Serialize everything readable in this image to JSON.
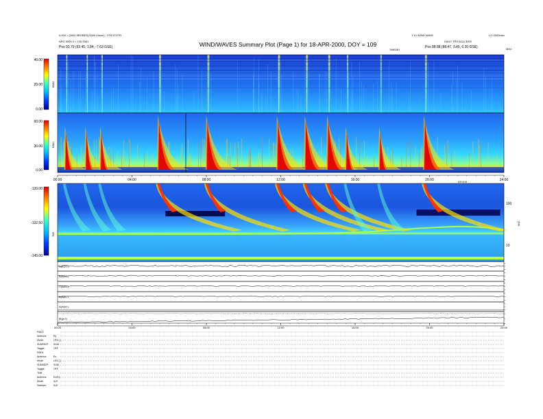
{
  "header": {
    "title": "WIND/WAVES Summary Plot (Page 1) for 18-APR-2000, DOY = 109",
    "tl_line1": "0.000 = [2000 0ROBES] 0000 (Vevlo) - 0T8 0TOTR",
    "tl_line2": "ARG 0000 2 = 130.0061",
    "tl_pos": "Pos    93.79 (93.45, 1.84, -7.63 GSE)",
    "tr_line1": "1.10 WIND WAVE",
    "tr_line2": "DAILY   TR0 0(11) 3002",
    "tr_pos": "Pos    88.88 (88.47, 3.45, 6.30 GSE)",
    "tr_corner": "LO 0000mhz",
    "mhz_label": "MHz",
    "khz_label": "KHZ",
    "time_corner_upper": "TIME/MH",
    "time_corner_lower": "DRY/DS"
  },
  "panels": {
    "rad2": {
      "name": "RAD2",
      "ticks": [
        "40.00",
        "20.00",
        "0.00"
      ]
    },
    "rad1": {
      "name": "RAD1",
      "ticks": [
        "60.00",
        "30.00",
        "0.00"
      ]
    },
    "tnr": {
      "name": "TNR",
      "ticks": [
        "-120.00",
        "-132.50",
        "-145.00"
      ],
      "right_ticks": [
        "100",
        "10"
      ]
    }
  },
  "time_ticks": [
    "00:00",
    "04:00",
    "08:00",
    "12:00",
    "16:00",
    "20:00",
    "24:00"
  ],
  "time_ticks_bottom": [
    "00:00",
    "04:00",
    "08:00",
    "12:00",
    "16:00",
    "20:00",
    "24:00"
  ],
  "line_panels": [
    {
      "label": "B(ADC)"
    },
    {
      "label": "B(ADC)"
    },
    {
      "label": "C(ADC)"
    },
    {
      "label": "B(ADC)"
    },
    {
      "label": "A(ADC)"
    },
    {
      "label": "|B|(nT)"
    }
  ],
  "footer": [
    {
      "k": "RAD2",
      "v": ""
    },
    {
      "k": "  Antenna",
      "v": "Ey"
    },
    {
      "k": "  Mode",
      "v": "LR3 [ ]"
    },
    {
      "k": "  SUM/SEP",
      "v": "SUM"
    },
    {
      "k": "  Toggle",
      "v": "OFF"
    },
    {
      "k": "RAD1",
      "v": ""
    },
    {
      "k": "  Antenna",
      "v": "Ex"
    },
    {
      "k": "  Mode",
      "v": "LR3 [ ]"
    },
    {
      "k": "  SUM/SEP",
      "v": "SUM"
    },
    {
      "k": "  Toggle",
      "v": "OFF"
    },
    {
      "k": "TNR",
      "v": ""
    },
    {
      "k": "  Antenna",
      "v": "Ex/Ey"
    },
    {
      "k": "  Mode",
      "v": "A,B"
    },
    {
      "k": "  Sweeps",
      "v": "A,B"
    }
  ],
  "chart_data": {
    "type": "heatmap",
    "title": "WIND/WAVES Summary Plot (Page 1) for 18-APR-2000, DOY = 109",
    "x_range_hours": [
      0,
      24
    ],
    "colormap": [
      "#0000a0",
      "#0040ff",
      "#00c0ff",
      "#40ffc0",
      "#ffff00",
      "#ff8000",
      "#e00000"
    ],
    "bursts_hours": [
      0.5,
      1.6,
      2.4,
      5.5,
      8.1,
      11.9,
      13.4,
      14.6,
      15.6,
      17.4,
      19.8
    ],
    "strong_bursts_hours": [
      5.5,
      8.1,
      11.9,
      13.4,
      14.6,
      19.8
    ],
    "panels": [
      {
        "name": "RAD2",
        "ylim": [
          0.0,
          40.0
        ]
      },
      {
        "name": "RAD1",
        "ylim": [
          0.0,
          60.0
        ]
      },
      {
        "name": "TNR",
        "ylim": [
          -145.0,
          -120.0
        ]
      }
    ]
  }
}
